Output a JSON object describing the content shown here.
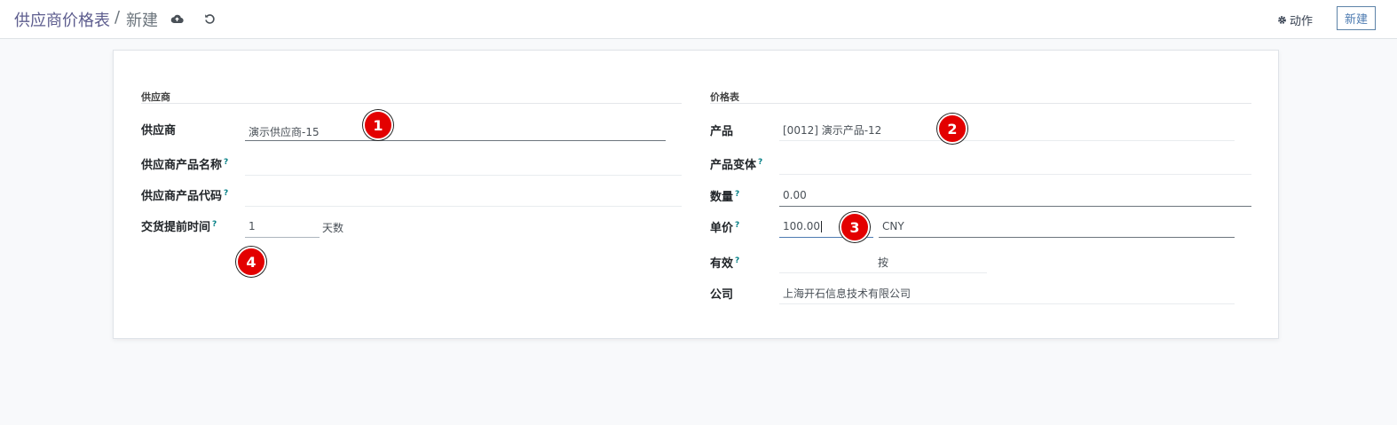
{
  "breadcrumb": {
    "root": "供应商价格表",
    "separator": "/",
    "current": "新建"
  },
  "toolbar": {
    "save_icon": "cloud-upload-icon",
    "discard_icon": "undo-icon",
    "action_label": "动作",
    "new_label": "新建"
  },
  "vendor_group": {
    "title": "供应商",
    "vendor_label": "供应商",
    "vendor_value": "演示供应商-15",
    "vendor_product_name_label": "供应商产品名称",
    "vendor_product_name_value": "",
    "vendor_product_code_label": "供应商产品代码",
    "vendor_product_code_value": "",
    "lead_time_label": "交货提前时间",
    "lead_time_value": "1",
    "lead_time_unit": "天数"
  },
  "pricelist_group": {
    "title": "价格表",
    "product_label": "产品",
    "product_value": "[0012] 演示产品-12",
    "variant_label": "产品变体",
    "variant_value": "",
    "quantity_label": "数量",
    "quantity_value": "0.00",
    "unit_price_label": "单价",
    "unit_price_value": "100.00",
    "currency_value": "CNY",
    "validity_label": "有效",
    "validity_middle": "按",
    "company_label": "公司",
    "company_value": "上海开石信息技术有限公司"
  },
  "help_mark": "?",
  "markers": [
    "1",
    "2",
    "3",
    "4"
  ],
  "colors": {
    "marker": "#e30000",
    "breadcrumb": "#5d5d8e",
    "new_button": "#4d7bb1"
  }
}
